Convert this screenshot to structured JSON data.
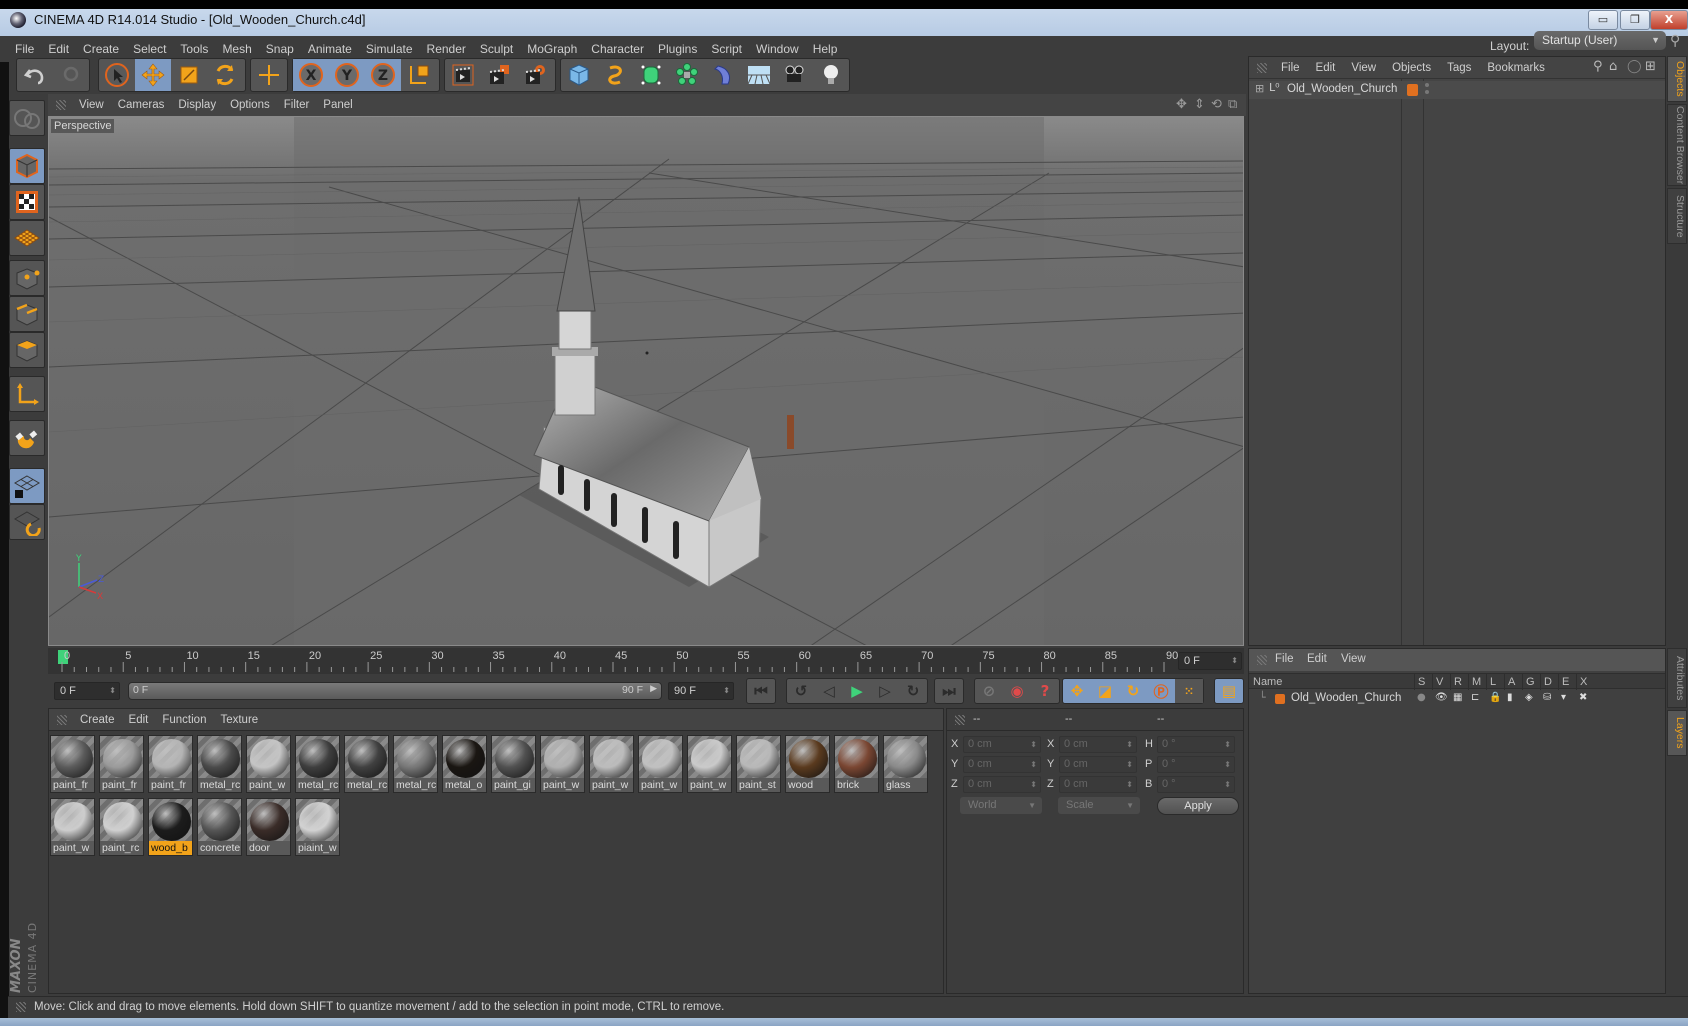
{
  "window": {
    "title": "CINEMA 4D R14.014 Studio - [Old_Wooden_Church.c4d]",
    "controls": [
      "minimize",
      "restore",
      "close"
    ]
  },
  "menubar": {
    "items": [
      "File",
      "Edit",
      "Create",
      "Select",
      "Tools",
      "Mesh",
      "Snap",
      "Animate",
      "Simulate",
      "Render",
      "Sculpt",
      "MoGraph",
      "Character",
      "Plugins",
      "Script",
      "Window",
      "Help"
    ],
    "layout_label": "Layout:",
    "layout_value": "Startup (User)"
  },
  "toolbar": {
    "groups": [
      {
        "name": "history",
        "items": [
          {
            "icon": "undo-icon",
            "active": false
          },
          {
            "icon": "redo-icon",
            "active": false
          }
        ]
      },
      {
        "name": "tools",
        "items": [
          {
            "icon": "live-selection-icon",
            "active": false
          },
          {
            "icon": "move-icon",
            "active": true
          },
          {
            "icon": "scale-icon",
            "active": false
          },
          {
            "icon": "rotate-icon",
            "active": false
          }
        ]
      },
      {
        "name": "recent",
        "items": [
          {
            "icon": "recent-tool-icon",
            "active": false
          }
        ]
      },
      {
        "name": "axis-lock",
        "items": [
          {
            "icon": "x-axis-icon",
            "active": true
          },
          {
            "icon": "y-axis-icon",
            "active": true
          },
          {
            "icon": "z-axis-icon",
            "active": true
          },
          {
            "icon": "coordinate-system-icon",
            "active": false
          }
        ]
      },
      {
        "name": "render",
        "items": [
          {
            "icon": "render-view-icon",
            "active": false
          },
          {
            "icon": "render-picture-viewer-icon",
            "active": false
          },
          {
            "icon": "render-settings-icon",
            "active": false
          }
        ]
      },
      {
        "name": "create",
        "items": [
          {
            "icon": "cube-icon",
            "active": false
          },
          {
            "icon": "spline-icon",
            "active": false
          },
          {
            "icon": "nurbs-icon",
            "active": false
          },
          {
            "icon": "array-icon",
            "active": false
          },
          {
            "icon": "deformer-icon",
            "active": false
          },
          {
            "icon": "floor-icon",
            "active": false
          },
          {
            "icon": "camera-icon",
            "active": false
          },
          {
            "icon": "light-icon",
            "active": false
          }
        ]
      }
    ]
  },
  "left_toolbar": {
    "items": [
      {
        "icon": "make-editable-icon",
        "active": false
      },
      {
        "icon": "model-mode-icon",
        "active": true
      },
      {
        "icon": "texture-mode-icon",
        "active": false
      },
      {
        "icon": "workplane-mode-icon",
        "active": false
      },
      {
        "icon": "points-mode-icon",
        "active": false
      },
      {
        "icon": "edges-mode-icon",
        "active": false
      },
      {
        "icon": "polygons-mode-icon",
        "active": false
      },
      {
        "icon": "axis-mode-icon",
        "active": false
      },
      {
        "icon": "magnet-icon",
        "active": false
      },
      {
        "icon": "locked-workplane-icon",
        "active": true
      },
      {
        "icon": "workplane-align-icon",
        "active": false
      }
    ],
    "logo_brand": "MAXON",
    "logo_product": "CINEMA 4D"
  },
  "viewport": {
    "menu": [
      "View",
      "Cameras",
      "Display",
      "Options",
      "Filter",
      "Panel"
    ],
    "camera_label": "Perspective",
    "nav_icons": [
      "pan-icon",
      "dolly-icon",
      "orbit-icon",
      "maximize-icon"
    ],
    "axis": {
      "x": "X",
      "y": "Y",
      "z": "Z"
    }
  },
  "timeline": {
    "ticks": [
      "0",
      "5",
      "10",
      "15",
      "20",
      "25",
      "30",
      "35",
      "40",
      "45",
      "50",
      "55",
      "60",
      "65",
      "70",
      "75",
      "80",
      "85",
      "90"
    ],
    "current_frame": "0 F",
    "start_field": "0 F",
    "range_start": "0 F",
    "range_end": "90 F",
    "end_field": "90 F",
    "current_frame_progress": 0
  },
  "playback": {
    "buttons": [
      "go-to-start-icon",
      "previous-key-icon",
      "previous-frame-icon",
      "play-icon",
      "next-frame-icon",
      "next-key-icon",
      "go-to-end-icon"
    ],
    "record_buttons": [
      "motion-record-icon",
      "record-active-objects-icon",
      "autokeying-icon"
    ],
    "key_buttons": [
      "key-position-icon",
      "key-scale-icon",
      "key-rotation-icon",
      "key-parameter-icon",
      "key-pla-icon"
    ],
    "timeline_button": "timeline-icon"
  },
  "materials": {
    "menu": [
      "Create",
      "Edit",
      "Function",
      "Texture"
    ],
    "items": [
      {
        "label": "paint_fr",
        "color": "#5a5a5a",
        "selected": false
      },
      {
        "label": "paint_fr",
        "color": "#9a9a9a",
        "selected": false
      },
      {
        "label": "paint_fr",
        "color": "#b4b4b4",
        "selected": false
      },
      {
        "label": "metal_rc",
        "color": "#4a4a4a",
        "selected": false
      },
      {
        "label": "paint_w",
        "color": "#c4c4c4",
        "selected": false
      },
      {
        "label": "metal_rc",
        "color": "#3e3e3e",
        "selected": false
      },
      {
        "label": "metal_rc",
        "color": "#404040",
        "selected": false
      },
      {
        "label": "metal_rc",
        "color": "#777777",
        "selected": false
      },
      {
        "label": "metal_o",
        "color": "#1a1612",
        "selected": false
      },
      {
        "label": "paint_gi",
        "color": "#505050",
        "selected": false
      },
      {
        "label": "paint_w",
        "color": "#b0b0b0",
        "selected": false
      },
      {
        "label": "paint_w",
        "color": "#bcbcbc",
        "selected": false
      },
      {
        "label": "paint_w",
        "color": "#c0c0c0",
        "selected": false
      },
      {
        "label": "paint_w",
        "color": "#cacaca",
        "selected": false
      },
      {
        "label": "paint_st",
        "color": "#b8b8b8",
        "selected": false
      },
      {
        "label": "wood",
        "color": "#5a3a1e",
        "selected": false
      },
      {
        "label": "brick",
        "color": "#7a4632",
        "selected": false
      },
      {
        "label": "glass",
        "color": "#8a8a8a",
        "selected": false
      },
      {
        "label": "paint_w",
        "color": "#cdcdcd",
        "selected": false
      },
      {
        "label": "paint_rc",
        "color": "#d0d0d0",
        "selected": false
      },
      {
        "label": "wood_b",
        "color": "#1c1c1c",
        "selected": true
      },
      {
        "label": "concrete",
        "color": "#555555",
        "selected": false
      },
      {
        "label": "door",
        "color": "#3a2c28",
        "selected": false
      },
      {
        "label": "piaint_w",
        "color": "#d2d2d2",
        "selected": false
      }
    ]
  },
  "coordinates": {
    "headers": [
      "--",
      "--",
      "--"
    ],
    "rows": [
      {
        "label1": "X",
        "val1": "0 cm",
        "label2": "X",
        "val2": "0 cm",
        "label3": "H",
        "val3": "0 °"
      },
      {
        "label1": "Y",
        "val1": "0 cm",
        "label2": "Y",
        "val2": "0 cm",
        "label3": "P",
        "val3": "0 °"
      },
      {
        "label1": "Z",
        "val1": "0 cm",
        "label2": "Z",
        "val2": "0 cm",
        "label3": "B",
        "val3": "0 °"
      }
    ],
    "space_dropdown": "World",
    "mode_dropdown": "Scale",
    "apply_label": "Apply"
  },
  "object_manager": {
    "menu": [
      "File",
      "Edit",
      "View",
      "Objects",
      "Tags",
      "Bookmarks"
    ],
    "tools": [
      "search-icon",
      "home-icon",
      "eye-icon",
      "new-window-icon"
    ],
    "objects": [
      {
        "name": "Old_Wooden_Church",
        "layer_color": "#e07020"
      }
    ]
  },
  "side_tabs_top": [
    {
      "label": "Objects",
      "active": true
    },
    {
      "label": "Content Browser",
      "active": false
    },
    {
      "label": "Structure",
      "active": false
    }
  ],
  "side_tabs_bottom": [
    {
      "label": "Attributes",
      "active": false
    },
    {
      "label": "Layers",
      "active": true
    }
  ],
  "layer_manager": {
    "menu": [
      "File",
      "Edit",
      "View"
    ],
    "name_header": "Name",
    "columns": [
      "S",
      "V",
      "R",
      "M",
      "L",
      "A",
      "G",
      "D",
      "E",
      "X"
    ],
    "layers": [
      {
        "name": "Old_Wooden_Church",
        "color": "#e07020"
      }
    ]
  },
  "status_bar": {
    "text": "Move: Click and drag to move elements. Hold down SHIFT to quantize movement / add to the selection in point mode, CTRL to remove."
  },
  "colors": {
    "accent_orange": "#f2a31a",
    "active_blue": "#7d9ac2",
    "panel_bg": "#3c3c3c",
    "viewport_bg": "#6b6b6b",
    "timeline_marker": "#3fd27a"
  }
}
